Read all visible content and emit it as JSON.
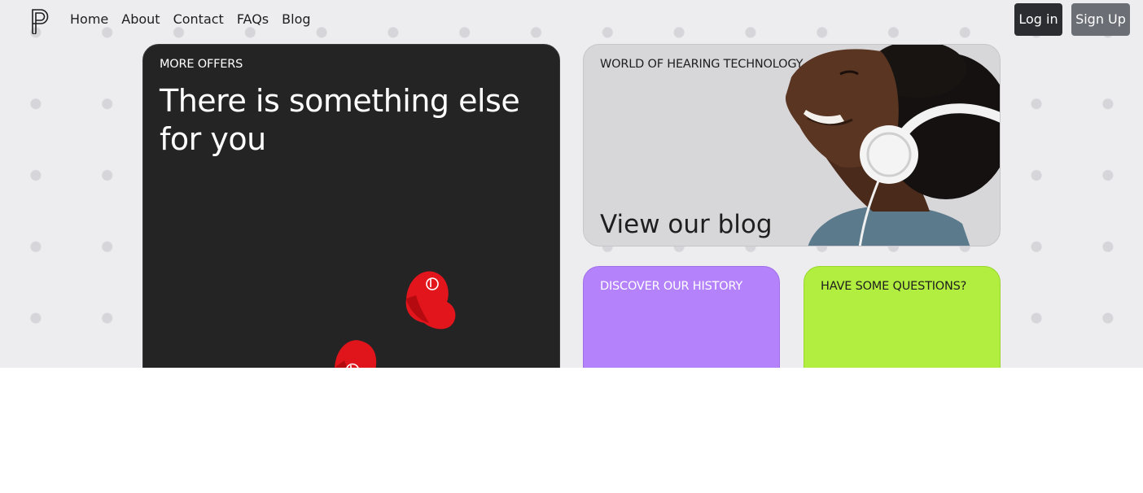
{
  "nav": {
    "links": [
      "Home",
      "About",
      "Contact",
      "FAQs",
      "Blog"
    ]
  },
  "auth": {
    "login_label": "Log in",
    "signup_label": "Sign Up"
  },
  "cards": {
    "offers": {
      "eyebrow": "MORE OFFERS",
      "heading": "There is something else for you"
    },
    "blog": {
      "eyebrow": "WORLD OF HEARING TECHNOLOGY",
      "heading": "View our blog"
    },
    "history": {
      "eyebrow": "DISCOVER OUR HISTORY"
    },
    "questions": {
      "eyebrow": "HAVE SOME QUESTIONS?"
    }
  },
  "icons": {
    "logo": "brand-logo-icon"
  },
  "colors": {
    "page_bg": "#ededf0",
    "offers_card": "#242424",
    "blog_card": "#d7d7da",
    "history_card": "#b482fa",
    "questions_card": "#b2ee3f",
    "login_button": "#2b2d31",
    "signup_button": "#6b6e75"
  }
}
